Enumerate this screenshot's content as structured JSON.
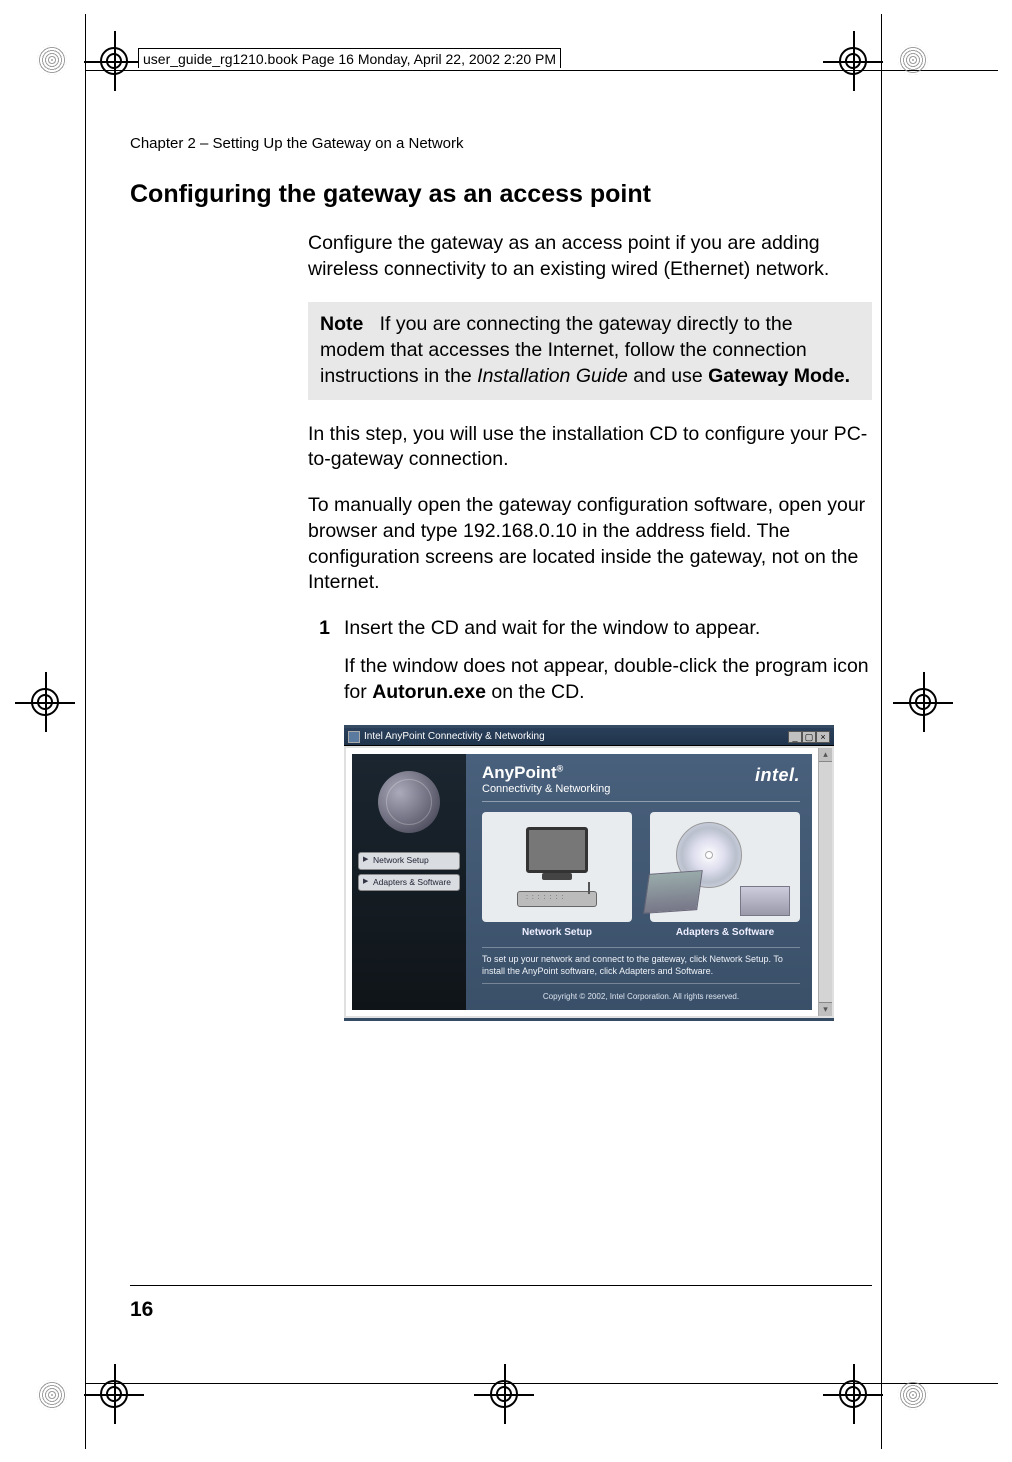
{
  "header_tag": "user_guide_rg1210.book  Page 16  Monday, April 22, 2002  2:20 PM",
  "chapter_line": "Chapter 2  –  Setting Up the Gateway on a Network",
  "section_title": "Configuring the gateway as an access point",
  "intro": "Configure the gateway as an access point if you are adding wireless connectivity to an existing wired (Ethernet) network.",
  "note": {
    "label": "Note",
    "before_italic": "If you are connecting the gateway directly to the modem that accesses the Internet, follow the connection instructions in the ",
    "italic": "Installation Guide",
    "after_italic": " and use ",
    "bold": "Gateway Mode."
  },
  "para2": "In this step, you will use the installation CD to configure your PC-to-gateway connection.",
  "para3": "To manually open the gateway configuration software, open your browser and type 192.168.0.10 in the address field. The configuration screens are located inside the gateway, not on the Internet.",
  "step1": {
    "num": "1",
    "line1": "Insert the CD and wait for the window to appear.",
    "line2_before": "If the window does not appear, double-click the program icon for ",
    "line2_bold": "Autorun.exe",
    "line2_after": " on the CD."
  },
  "screenshot": {
    "titlebar": "Intel AnyPoint Connectivity & Networking",
    "side_btn1": "Network Setup",
    "side_btn2": "Adapters & Software",
    "brand_title": "AnyPoint",
    "brand_reg": "®",
    "brand_sub": "Connectivity & Networking",
    "brand_logo": "intel.",
    "panel1_caption": "Network Setup",
    "panel2_caption": "Adapters & Software",
    "info_text": "To set up your network and connect to the gateway, click Network Setup. To install the AnyPoint software, click Adapters and Software.",
    "copyright": "Copyright © 2002, Intel Corporation. All rights reserved."
  },
  "page_number": "16"
}
